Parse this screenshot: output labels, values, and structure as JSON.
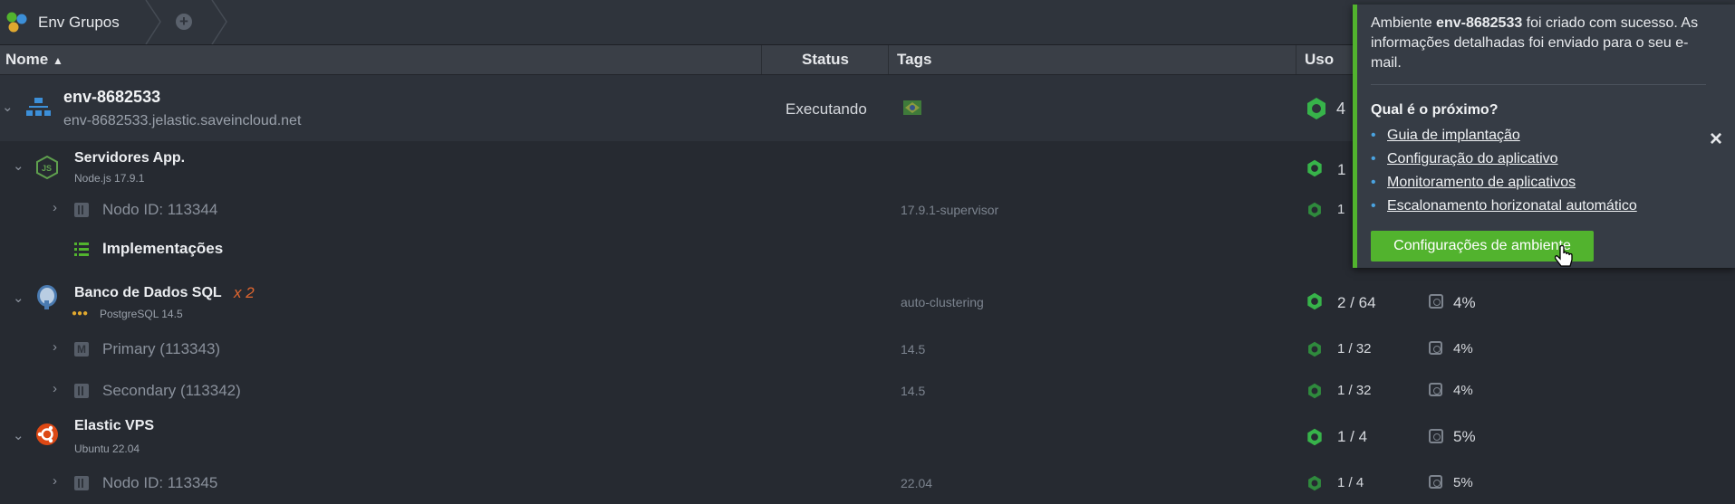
{
  "tabs": {
    "group_label": "Env Grupos",
    "add": "+"
  },
  "columns": {
    "name": "Nome",
    "status": "Status",
    "tags": "Tags",
    "usage": "Uso"
  },
  "env": {
    "name": "env-8682533",
    "domain": "env-8682533.jelastic.saveincloud.net",
    "status": "Executando",
    "usage": "4"
  },
  "groups": {
    "app": {
      "title": "Servidores App.",
      "sub": "Node.js 17.9.1",
      "usage": "1",
      "node": {
        "label": "Nodo ID: 113344",
        "tag": "17.9.1-supervisor",
        "usage": "1"
      },
      "deploy": "Implementações"
    },
    "db": {
      "title": "Banco de Dados SQL",
      "multiplier": "x 2",
      "sub": "PostgreSQL 14.5",
      "tag": "auto-clustering",
      "usage": "2 / 64",
      "disk": "4%",
      "primary": {
        "label": "Primary (113343)",
        "tag": "14.5",
        "usage": "1 / 32",
        "disk": "4%"
      },
      "secondary": {
        "label": "Secondary (113342)",
        "tag": "14.5",
        "usage": "1 / 32",
        "disk": "4%"
      }
    },
    "vps": {
      "title": "Elastic VPS",
      "sub": "Ubuntu 22.04",
      "usage": "1 / 4",
      "disk": "5%",
      "node": {
        "label": "Nodo ID: 113345",
        "tag": "22.04",
        "usage": "1 / 4",
        "disk": "5%"
      }
    }
  },
  "popup": {
    "msg_prefix": "Ambiente ",
    "msg_env": "env-8682533",
    "msg_suffix": " foi criado com sucesso. As informações detalhadas foi enviado para o seu e-mail.",
    "question": "Qual é o próximo?",
    "links": [
      "Guia de implantação",
      "Configuração do aplicativo",
      "Monitoramento de aplicativos",
      "Escalonamento horizonatal automático"
    ],
    "button": "Configurações de ambiente",
    "close": "×"
  },
  "colors": {
    "accent_green": "#52b32e",
    "node_green": "#37b34a",
    "db_orange": "#e0662f"
  }
}
